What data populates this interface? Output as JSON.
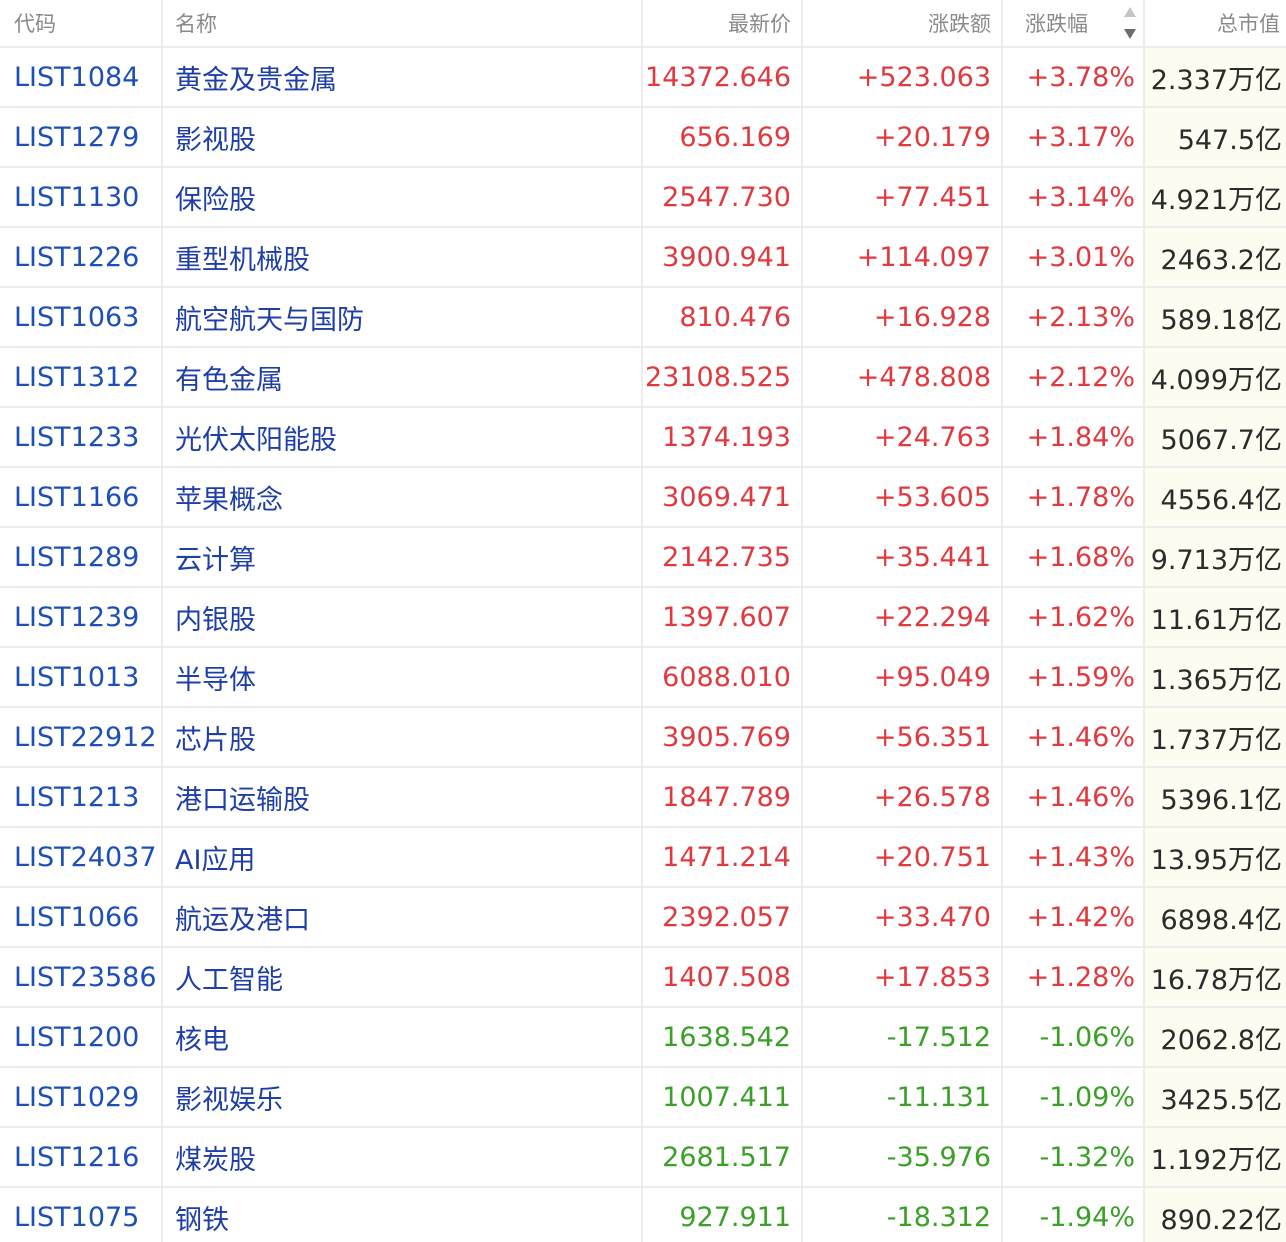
{
  "header": {
    "code": "代码",
    "name": "名称",
    "price": "最新价",
    "change": "涨跌额",
    "pct": "涨跌幅",
    "cap": "总市值"
  },
  "colors": {
    "up": "#e0393e",
    "down": "#3aa027",
    "link": "#1d4fb8"
  },
  "rows": [
    {
      "code": "LIST1084",
      "name": "黄金及贵金属",
      "price": "14372.646",
      "change": "+523.063",
      "pct": "+3.78%",
      "cap": "2.337万亿",
      "dir": "up"
    },
    {
      "code": "LIST1279",
      "name": "影视股",
      "price": "656.169",
      "change": "+20.179",
      "pct": "+3.17%",
      "cap": "547.5亿",
      "dir": "up"
    },
    {
      "code": "LIST1130",
      "name": "保险股",
      "price": "2547.730",
      "change": "+77.451",
      "pct": "+3.14%",
      "cap": "4.921万亿",
      "dir": "up"
    },
    {
      "code": "LIST1226",
      "name": "重型机械股",
      "price": "3900.941",
      "change": "+114.097",
      "pct": "+3.01%",
      "cap": "2463.2亿",
      "dir": "up"
    },
    {
      "code": "LIST1063",
      "name": "航空航天与国防",
      "price": "810.476",
      "change": "+16.928",
      "pct": "+2.13%",
      "cap": "589.18亿",
      "dir": "up"
    },
    {
      "code": "LIST1312",
      "name": "有色金属",
      "price": "23108.525",
      "change": "+478.808",
      "pct": "+2.12%",
      "cap": "4.099万亿",
      "dir": "up"
    },
    {
      "code": "LIST1233",
      "name": "光伏太阳能股",
      "price": "1374.193",
      "change": "+24.763",
      "pct": "+1.84%",
      "cap": "5067.7亿",
      "dir": "up"
    },
    {
      "code": "LIST1166",
      "name": "苹果概念",
      "price": "3069.471",
      "change": "+53.605",
      "pct": "+1.78%",
      "cap": "4556.4亿",
      "dir": "up"
    },
    {
      "code": "LIST1289",
      "name": "云计算",
      "price": "2142.735",
      "change": "+35.441",
      "pct": "+1.68%",
      "cap": "9.713万亿",
      "dir": "up"
    },
    {
      "code": "LIST1239",
      "name": "内银股",
      "price": "1397.607",
      "change": "+22.294",
      "pct": "+1.62%",
      "cap": "11.61万亿",
      "dir": "up"
    },
    {
      "code": "LIST1013",
      "name": "半导体",
      "price": "6088.010",
      "change": "+95.049",
      "pct": "+1.59%",
      "cap": "1.365万亿",
      "dir": "up"
    },
    {
      "code": "LIST22912",
      "name": "芯片股",
      "price": "3905.769",
      "change": "+56.351",
      "pct": "+1.46%",
      "cap": "1.737万亿",
      "dir": "up"
    },
    {
      "code": "LIST1213",
      "name": "港口运输股",
      "price": "1847.789",
      "change": "+26.578",
      "pct": "+1.46%",
      "cap": "5396.1亿",
      "dir": "up"
    },
    {
      "code": "LIST24037",
      "name": "AI应用",
      "price": "1471.214",
      "change": "+20.751",
      "pct": "+1.43%",
      "cap": "13.95万亿",
      "dir": "up"
    },
    {
      "code": "LIST1066",
      "name": "航运及港口",
      "price": "2392.057",
      "change": "+33.470",
      "pct": "+1.42%",
      "cap": "6898.4亿",
      "dir": "up"
    },
    {
      "code": "LIST23586",
      "name": "人工智能",
      "price": "1407.508",
      "change": "+17.853",
      "pct": "+1.28%",
      "cap": "16.78万亿",
      "dir": "up"
    },
    {
      "code": "LIST1200",
      "name": "核电",
      "price": "1638.542",
      "change": "-17.512",
      "pct": "-1.06%",
      "cap": "2062.8亿",
      "dir": "down"
    },
    {
      "code": "LIST1029",
      "name": "影视娱乐",
      "price": "1007.411",
      "change": "-11.131",
      "pct": "-1.09%",
      "cap": "3425.5亿",
      "dir": "down"
    },
    {
      "code": "LIST1216",
      "name": "煤炭股",
      "price": "2681.517",
      "change": "-35.976",
      "pct": "-1.32%",
      "cap": "1.192万亿",
      "dir": "down"
    },
    {
      "code": "LIST1075",
      "name": "钢铁",
      "price": "927.911",
      "change": "-18.312",
      "pct": "-1.94%",
      "cap": "890.22亿",
      "dir": "down"
    }
  ]
}
